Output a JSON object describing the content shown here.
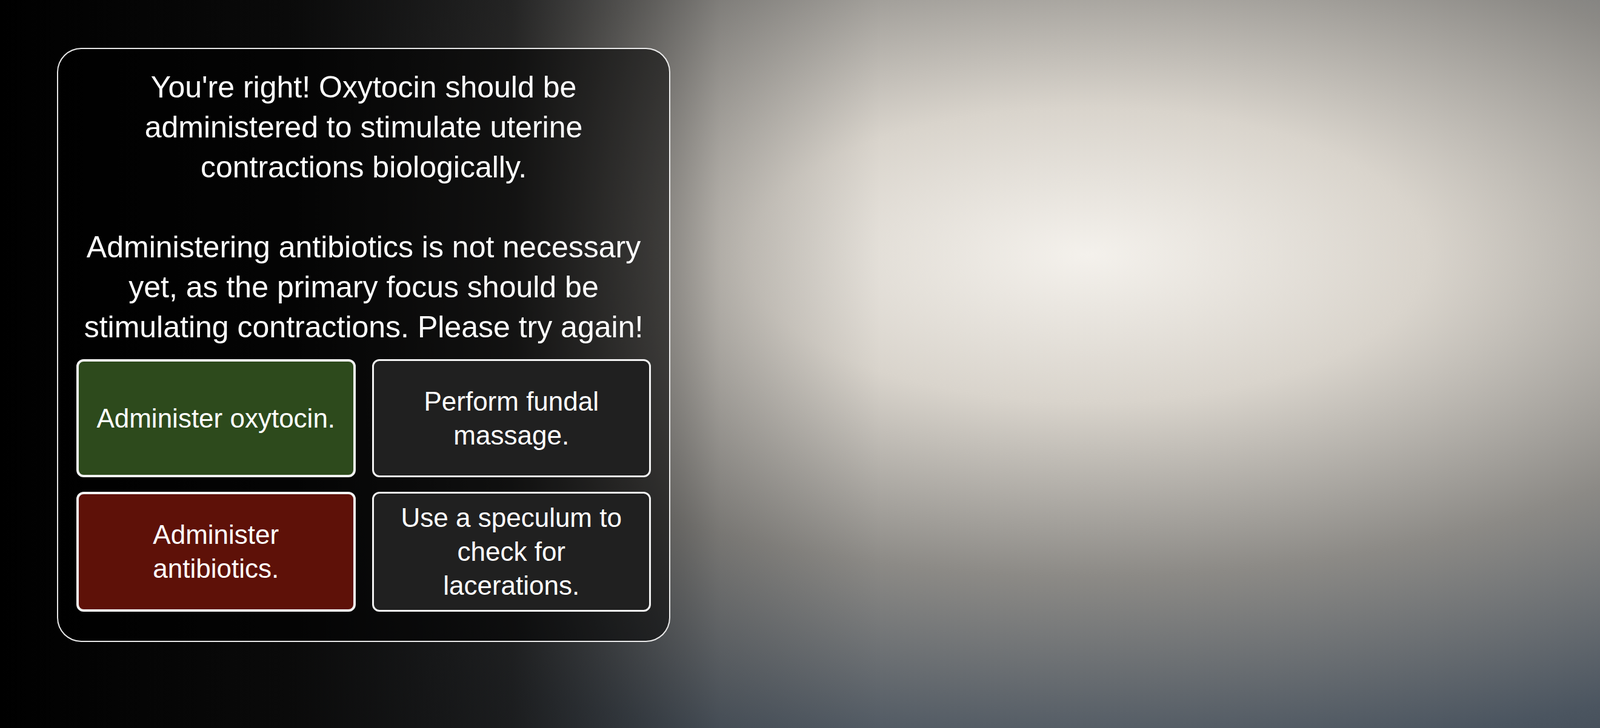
{
  "feedback": {
    "paragraphs": [
      "You're right! Oxytocin should be administered to stimulate uterine contractions biologically.",
      "Administering antibiotics is not necessary yet, as the primary focus should be stimulating contractions. Please try again!"
    ]
  },
  "options": [
    {
      "label": "Administer oxytocin.",
      "selected": true,
      "color": "#2d4a1c"
    },
    {
      "label": "Perform fundal massage.",
      "selected": false,
      "color": "#202020"
    },
    {
      "label": "Administer antibiotics.",
      "selected": true,
      "color": "#5e1108"
    },
    {
      "label": "Use a speculum to check for lacerations.",
      "selected": false,
      "color": "#202020"
    }
  ]
}
